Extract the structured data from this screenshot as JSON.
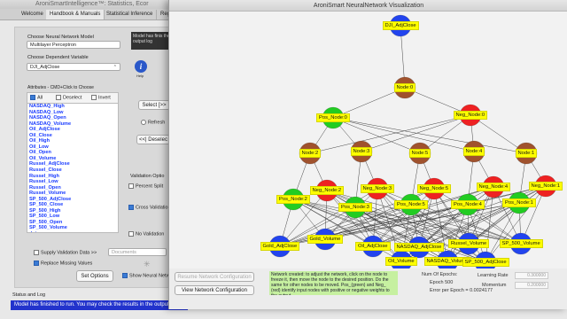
{
  "main_window": {
    "title": "AroniSmartIntelligence™: Statistics, Ecor"
  },
  "tabs": [
    {
      "label": "Welcome"
    },
    {
      "label": "Handbook & Manuals"
    },
    {
      "label": "Statistical Inference"
    },
    {
      "label": "Regr"
    }
  ],
  "model": {
    "choose_label": "Choose  Neural Network Model",
    "selected": "Multilayer Perceptron",
    "dep_label": "Choose Dependent Variable",
    "dep_selected": "DJI_AdjClose"
  },
  "info_box": {
    "text": "Model has finis the output log"
  },
  "info_icon": {
    "label": "Help"
  },
  "attributes": {
    "header": "Attributes - CMD+Click to Choose",
    "all": "All",
    "deselect": "Deselect",
    "invert": "Invert",
    "items": [
      "NASDAQ_High",
      "NASDAQ_Low",
      "NASDAQ_Open",
      "NASDAQ_Volume",
      "Oil_AdjClose",
      "Oil_Close",
      "Oil_High",
      "Oil_Low",
      "Oil_Open",
      "Oil_Volume",
      "Russel_AdjClose",
      "Russel_Close",
      "Russel_High",
      "Russel_Low",
      "Russel_Open",
      "Russel_Volume",
      "SP_500_AdjClose",
      "SP_500_Close",
      "SP_500_High",
      "SP_500_Low",
      "SP_500_Open",
      "SP_500_Volume",
      "date"
    ]
  },
  "buttons": {
    "select": "Select [>>",
    "refresh": "Refresh",
    "deselect": "<<| Deselec",
    "set_options": "Set Options",
    "resume_config": "Resume Network Configuration",
    "view_config": "View Network Configuration"
  },
  "validation": {
    "label": "Validation Optio",
    "percent_split": "Percent Split",
    "cross": "Cross Validatio",
    "none": "No Validation"
  },
  "checks": {
    "supply_validation": "Supply Validation Data >>",
    "documents": "Documents",
    "replace_missing": "Replace Missing Values",
    "show_neural": "Show Neural Netw"
  },
  "status": {
    "label": "Status and Log",
    "text": "Model has finished to run. You may check the results in the output log"
  },
  "viz_window": {
    "title": "AroniSmart NeuralNetwork Visualization"
  },
  "network": {
    "output": "DJI_AdjClose",
    "nodes": [
      "Node:0",
      "Pos_Node:0",
      "Neg_Node:0",
      "Node:2",
      "Node:3",
      "Node:5",
      "Node:4",
      "Node:1",
      "Neg_Node:2",
      "Neg_Node:3",
      "Neg_Node:5",
      "Neg_Node:4",
      "Neg_Node:1",
      "Pos_Node:2",
      "Pos_Node:3",
      "Pos_Node:5",
      "Pos_Node:4",
      "Pos_Node:1"
    ],
    "inputs": [
      "Gold_Volume",
      "Gold_AdjClose",
      "Oil_AdjClose",
      "Oil_Volume",
      "NASDAQ_AdjClose",
      "NASDAQ_Volume",
      "Russel_Volume",
      "SP_500_AdjClose",
      "SP_500_Volume"
    ]
  },
  "bottom": {
    "message": "Network created: to adjust the network, click on the node to freeze it, then move the node to the desired position. Do the same for other nodes to be moved. Pos_(green) and Neg_ (red) identify input nodes with positive or negative weights to the output",
    "epochs_label": "Num Of Epochs:",
    "epoch": "Epoch  500",
    "error": "Error per Epoch = 0.0024177",
    "lr_label": "Learning Rate",
    "lr_value": "0.300000",
    "momentum_label": "Momentum",
    "momentum_value": "0.200000"
  },
  "colors": {
    "status_bar": "#2233cc",
    "attr_text": "#1a3cff",
    "node_label": "#ffff00",
    "positive": "#22cc22",
    "negative": "#ee2222",
    "hidden": "#a0522d",
    "input_output": "#2244ee"
  }
}
